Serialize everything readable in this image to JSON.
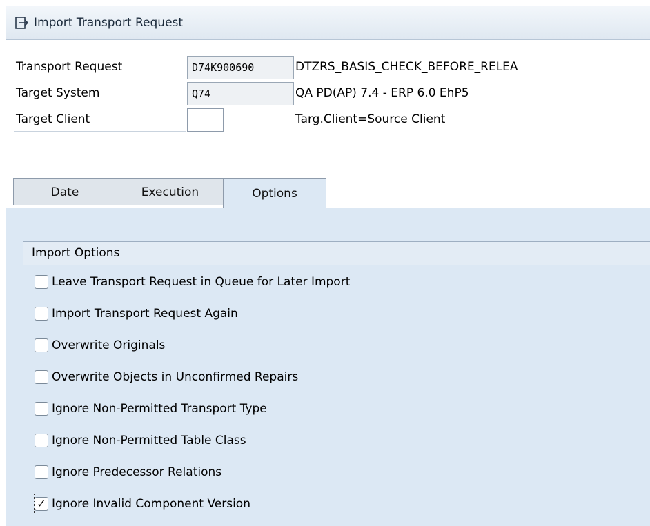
{
  "window": {
    "title": "Import Transport Request",
    "title_icon": "import-icon"
  },
  "fields": [
    {
      "label": "Transport Request",
      "value": "D74K900690",
      "description": "DTZRS_BASIS_CHECK_BEFORE_RELEA"
    },
    {
      "label": "Target System",
      "value": "Q74",
      "description": "QA PD(AP) 7.4 - ERP 6.0 EhP5"
    },
    {
      "label": "Target Client",
      "value": "",
      "description": "Targ.Client=Source Client"
    }
  ],
  "tabs": [
    {
      "label": "Date",
      "active": false
    },
    {
      "label": "Execution",
      "active": false
    },
    {
      "label": "Options",
      "active": true
    }
  ],
  "import_options": {
    "title": "Import Options",
    "items": [
      {
        "label": "Leave Transport Request in Queue for Later Import",
        "checked": false
      },
      {
        "label": "Import Transport Request Again",
        "checked": false
      },
      {
        "label": "Overwrite Originals",
        "checked": false
      },
      {
        "label": "Overwrite Objects in Unconfirmed Repairs",
        "checked": false
      },
      {
        "label": "Ignore Non-Permitted Transport Type",
        "checked": false
      },
      {
        "label": "Ignore Non-Permitted Table Class",
        "checked": false
      },
      {
        "label": "Ignore Predecessor Relations",
        "checked": false
      },
      {
        "label": "Ignore Invalid Component Version",
        "checked": true
      }
    ]
  },
  "colors": {
    "panel_bg": "#dce8f4",
    "border": "#8e9bab"
  }
}
